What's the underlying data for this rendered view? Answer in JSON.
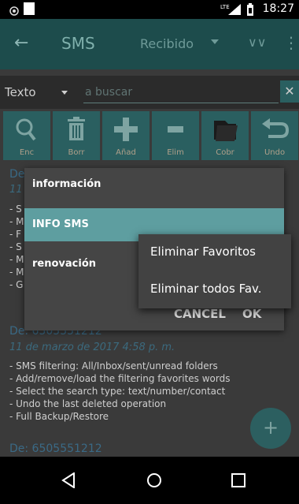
{
  "status_bar": {
    "time": "18:27",
    "network": "LTE"
  },
  "app_bar": {
    "back_icon": "back-arrow-icon",
    "title": "SMS",
    "folder_select": "Recibido",
    "colors": {
      "bar": "#1d4c4c",
      "accent": "#2a5f60"
    }
  },
  "search": {
    "type_select": "Texto",
    "placeholder": "a buscar",
    "clear_icon": "close-icon"
  },
  "actions": [
    {
      "label": "Enc",
      "icon": "search-icon"
    },
    {
      "label": "Borr",
      "icon": "trash-icon"
    },
    {
      "label": "Añad",
      "icon": "plus-icon"
    },
    {
      "label": "Elim",
      "icon": "minus-icon"
    },
    {
      "label": "Cobr",
      "icon": "folder-icon"
    },
    {
      "label": "Undo",
      "icon": "undo-icon"
    }
  ],
  "messages": [
    {
      "sender": "De:",
      "date": "11",
      "lines": [
        "- S",
        "- M",
        "- F",
        "- S",
        "- M",
        "- M",
        "- G"
      ]
    },
    {
      "sender": "De:  6505551212",
      "date": "11 de marzo de 2017 4:58 p. m.",
      "lines": [
        "- SMS filtering: All/Inbox/sent/unread folders",
        "- Add/remove/load the filtering favorites words",
        "- Select the search type: text/number/contact",
        "- Undo the last deleted operation",
        "- Full Backup/Restore"
      ]
    },
    {
      "sender": "De:  6505551212"
    }
  ],
  "dialog": {
    "items": [
      "información",
      "INFO SMS",
      "renovación"
    ],
    "selected_index": 1,
    "cancel": "CANCEL",
    "ok": "OK",
    "highlight_color": "#5e9ea0"
  },
  "popup_menu": {
    "items": [
      "Eliminar Favoritos",
      "Eliminar todos Fav."
    ]
  },
  "fab": {
    "label": "+"
  }
}
